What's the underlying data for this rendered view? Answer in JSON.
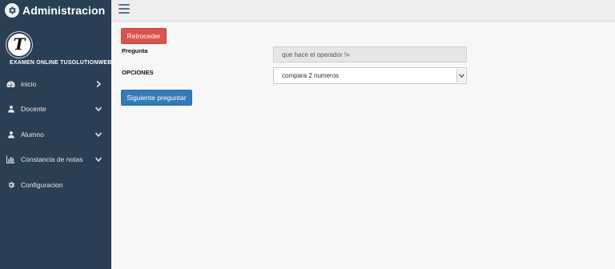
{
  "sidebar": {
    "title": "Administracion",
    "site_name": "EXAMEN ONLINE TUSOLUTIONWEB",
    "logo_letter": "T",
    "items": [
      {
        "label": "inicio",
        "icon": "dashboard-icon",
        "arrow": "chevron-right-icon"
      },
      {
        "label": "Docente",
        "icon": "user-icon",
        "arrow": "chevron-down-icon"
      },
      {
        "label": "Alumno",
        "icon": "user-icon",
        "arrow": "chevron-down-icon"
      },
      {
        "label": "Constancia de notas",
        "icon": "bar-chart-icon",
        "arrow": "chevron-down-icon"
      },
      {
        "label": "Configuracion",
        "icon": "gear-icon",
        "arrow": ""
      }
    ]
  },
  "topbar": {
    "toggle_icon": "hamburger-icon"
  },
  "form": {
    "back_label": "Retroceder",
    "question_label": "Pregunta",
    "question_value": "que hace el operador !=",
    "options_label": "OPCIONES",
    "options_selected": "compara 2 numeros",
    "next_label": "Siguiente preguntar"
  },
  "colors": {
    "sidebar_bg": "#2a3f54",
    "danger": "#d9534f",
    "primary": "#337ab7"
  }
}
